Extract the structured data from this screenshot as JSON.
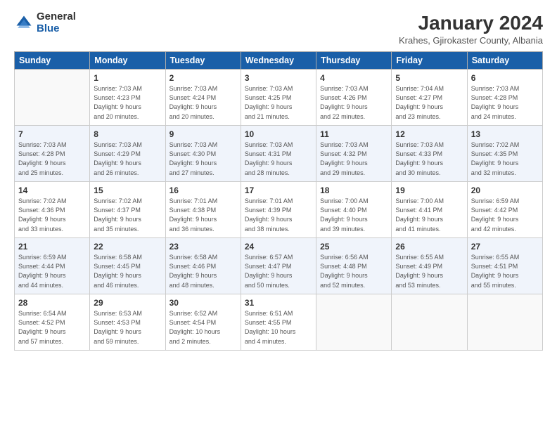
{
  "logo": {
    "general": "General",
    "blue": "Blue"
  },
  "title": "January 2024",
  "subtitle": "Krahes, Gjirokaster County, Albania",
  "days_header": [
    "Sunday",
    "Monday",
    "Tuesday",
    "Wednesday",
    "Thursday",
    "Friday",
    "Saturday"
  ],
  "weeks": [
    {
      "stripe": false,
      "days": [
        {
          "num": "",
          "info": ""
        },
        {
          "num": "1",
          "info": "Sunrise: 7:03 AM\nSunset: 4:23 PM\nDaylight: 9 hours\nand 20 minutes."
        },
        {
          "num": "2",
          "info": "Sunrise: 7:03 AM\nSunset: 4:24 PM\nDaylight: 9 hours\nand 20 minutes."
        },
        {
          "num": "3",
          "info": "Sunrise: 7:03 AM\nSunset: 4:25 PM\nDaylight: 9 hours\nand 21 minutes."
        },
        {
          "num": "4",
          "info": "Sunrise: 7:03 AM\nSunset: 4:26 PM\nDaylight: 9 hours\nand 22 minutes."
        },
        {
          "num": "5",
          "info": "Sunrise: 7:04 AM\nSunset: 4:27 PM\nDaylight: 9 hours\nand 23 minutes."
        },
        {
          "num": "6",
          "info": "Sunrise: 7:03 AM\nSunset: 4:28 PM\nDaylight: 9 hours\nand 24 minutes."
        }
      ]
    },
    {
      "stripe": true,
      "days": [
        {
          "num": "7",
          "info": "Sunrise: 7:03 AM\nSunset: 4:28 PM\nDaylight: 9 hours\nand 25 minutes."
        },
        {
          "num": "8",
          "info": "Sunrise: 7:03 AM\nSunset: 4:29 PM\nDaylight: 9 hours\nand 26 minutes."
        },
        {
          "num": "9",
          "info": "Sunrise: 7:03 AM\nSunset: 4:30 PM\nDaylight: 9 hours\nand 27 minutes."
        },
        {
          "num": "10",
          "info": "Sunrise: 7:03 AM\nSunset: 4:31 PM\nDaylight: 9 hours\nand 28 minutes."
        },
        {
          "num": "11",
          "info": "Sunrise: 7:03 AM\nSunset: 4:32 PM\nDaylight: 9 hours\nand 29 minutes."
        },
        {
          "num": "12",
          "info": "Sunrise: 7:03 AM\nSunset: 4:33 PM\nDaylight: 9 hours\nand 30 minutes."
        },
        {
          "num": "13",
          "info": "Sunrise: 7:02 AM\nSunset: 4:35 PM\nDaylight: 9 hours\nand 32 minutes."
        }
      ]
    },
    {
      "stripe": false,
      "days": [
        {
          "num": "14",
          "info": "Sunrise: 7:02 AM\nSunset: 4:36 PM\nDaylight: 9 hours\nand 33 minutes."
        },
        {
          "num": "15",
          "info": "Sunrise: 7:02 AM\nSunset: 4:37 PM\nDaylight: 9 hours\nand 35 minutes."
        },
        {
          "num": "16",
          "info": "Sunrise: 7:01 AM\nSunset: 4:38 PM\nDaylight: 9 hours\nand 36 minutes."
        },
        {
          "num": "17",
          "info": "Sunrise: 7:01 AM\nSunset: 4:39 PM\nDaylight: 9 hours\nand 38 minutes."
        },
        {
          "num": "18",
          "info": "Sunrise: 7:00 AM\nSunset: 4:40 PM\nDaylight: 9 hours\nand 39 minutes."
        },
        {
          "num": "19",
          "info": "Sunrise: 7:00 AM\nSunset: 4:41 PM\nDaylight: 9 hours\nand 41 minutes."
        },
        {
          "num": "20",
          "info": "Sunrise: 6:59 AM\nSunset: 4:42 PM\nDaylight: 9 hours\nand 42 minutes."
        }
      ]
    },
    {
      "stripe": true,
      "days": [
        {
          "num": "21",
          "info": "Sunrise: 6:59 AM\nSunset: 4:44 PM\nDaylight: 9 hours\nand 44 minutes."
        },
        {
          "num": "22",
          "info": "Sunrise: 6:58 AM\nSunset: 4:45 PM\nDaylight: 9 hours\nand 46 minutes."
        },
        {
          "num": "23",
          "info": "Sunrise: 6:58 AM\nSunset: 4:46 PM\nDaylight: 9 hours\nand 48 minutes."
        },
        {
          "num": "24",
          "info": "Sunrise: 6:57 AM\nSunset: 4:47 PM\nDaylight: 9 hours\nand 50 minutes."
        },
        {
          "num": "25",
          "info": "Sunrise: 6:56 AM\nSunset: 4:48 PM\nDaylight: 9 hours\nand 52 minutes."
        },
        {
          "num": "26",
          "info": "Sunrise: 6:55 AM\nSunset: 4:49 PM\nDaylight: 9 hours\nand 53 minutes."
        },
        {
          "num": "27",
          "info": "Sunrise: 6:55 AM\nSunset: 4:51 PM\nDaylight: 9 hours\nand 55 minutes."
        }
      ]
    },
    {
      "stripe": false,
      "days": [
        {
          "num": "28",
          "info": "Sunrise: 6:54 AM\nSunset: 4:52 PM\nDaylight: 9 hours\nand 57 minutes."
        },
        {
          "num": "29",
          "info": "Sunrise: 6:53 AM\nSunset: 4:53 PM\nDaylight: 9 hours\nand 59 minutes."
        },
        {
          "num": "30",
          "info": "Sunrise: 6:52 AM\nSunset: 4:54 PM\nDaylight: 10 hours\nand 2 minutes."
        },
        {
          "num": "31",
          "info": "Sunrise: 6:51 AM\nSunset: 4:55 PM\nDaylight: 10 hours\nand 4 minutes."
        },
        {
          "num": "",
          "info": ""
        },
        {
          "num": "",
          "info": ""
        },
        {
          "num": "",
          "info": ""
        }
      ]
    }
  ]
}
